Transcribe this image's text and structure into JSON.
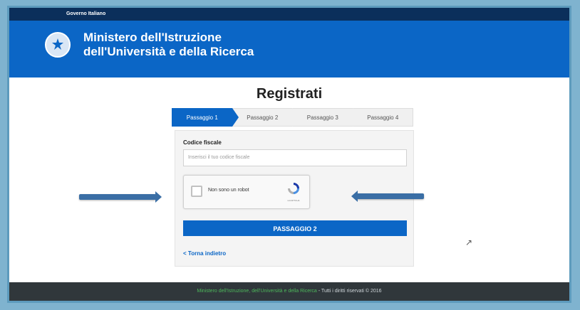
{
  "top_bar": {
    "label": "Governo Italiano"
  },
  "header": {
    "line1": "Ministero dell'Istruzione",
    "line2": "dell'Università e della Ricerca"
  },
  "title": "Registrati",
  "steps": [
    "Passaggio 1",
    "Passaggio 2",
    "Passaggio 3",
    "Passaggio 4"
  ],
  "form": {
    "label": "Codice fiscale",
    "placeholder": "Inserisci il tuo codice fiscale",
    "captcha_text": "Non sono un robot",
    "captcha_brand": "reCAPTCHA",
    "submit": "PASSAGGIO 2",
    "back": "< Torna indietro"
  },
  "footer": {
    "link": "Ministero dell'Istruzione, dell'Università e della Ricerca",
    "text": " - Tutti i diritti riservati © 2016"
  },
  "colors": {
    "brand": "#0b66c6",
    "top_bar": "#0b2f5b",
    "footer": "#30373b"
  }
}
